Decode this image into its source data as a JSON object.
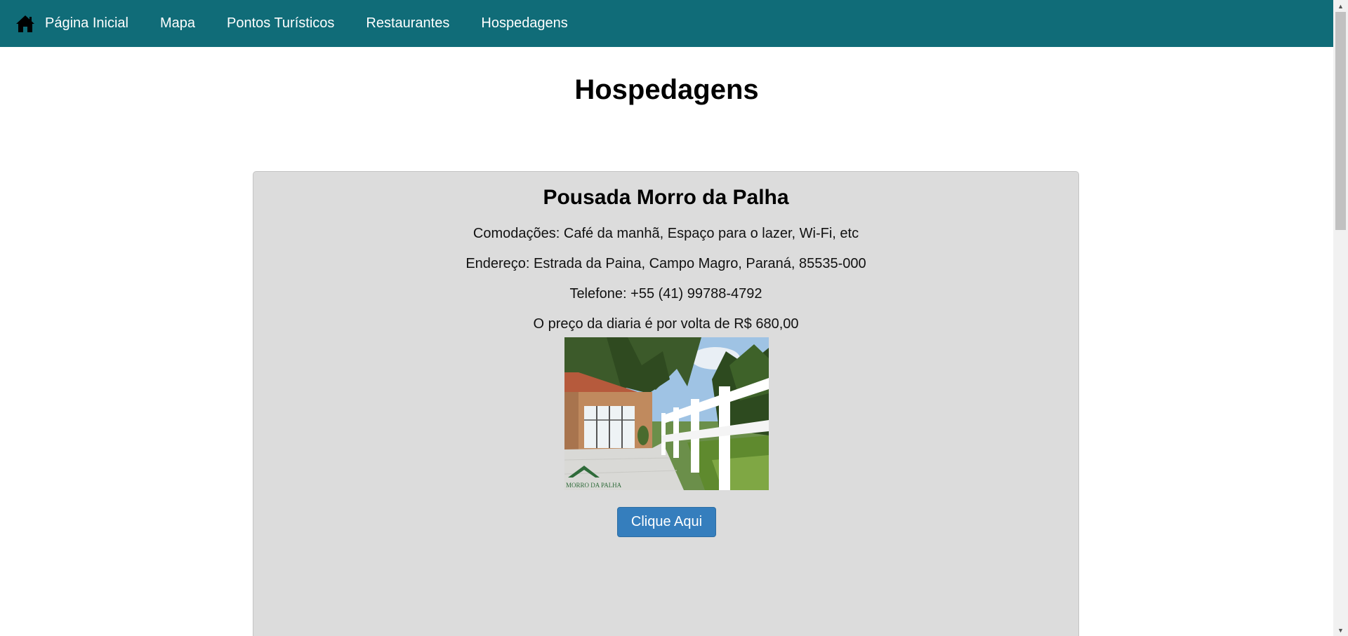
{
  "nav": {
    "home_label": "Página Inicial",
    "items": [
      {
        "label": "Mapa"
      },
      {
        "label": "Pontos Turísticos"
      },
      {
        "label": "Restaurantes"
      },
      {
        "label": "Hospedagens"
      }
    ]
  },
  "page": {
    "title": "Hospedagens"
  },
  "listing": {
    "name": "Pousada Morro da Palha",
    "amenities": "Comodações: Café da manhã, Espaço para o lazer, Wi-Fi, etc",
    "address": "Endereço: Estrada da Paina, Campo Magro, Paraná, 85535-000",
    "phone": "Telefone: +55 (41) 99788-4792",
    "price": "O preço da diaria é por volta de R$ 680,00",
    "photo_logo_text": "MORRO DA PALHA",
    "button_label": "Clique Aqui"
  },
  "colors": {
    "navbar": "#106c78",
    "card": "#dcdcdc",
    "button": "#357ebd"
  },
  "icons": {
    "home": "home-icon"
  }
}
